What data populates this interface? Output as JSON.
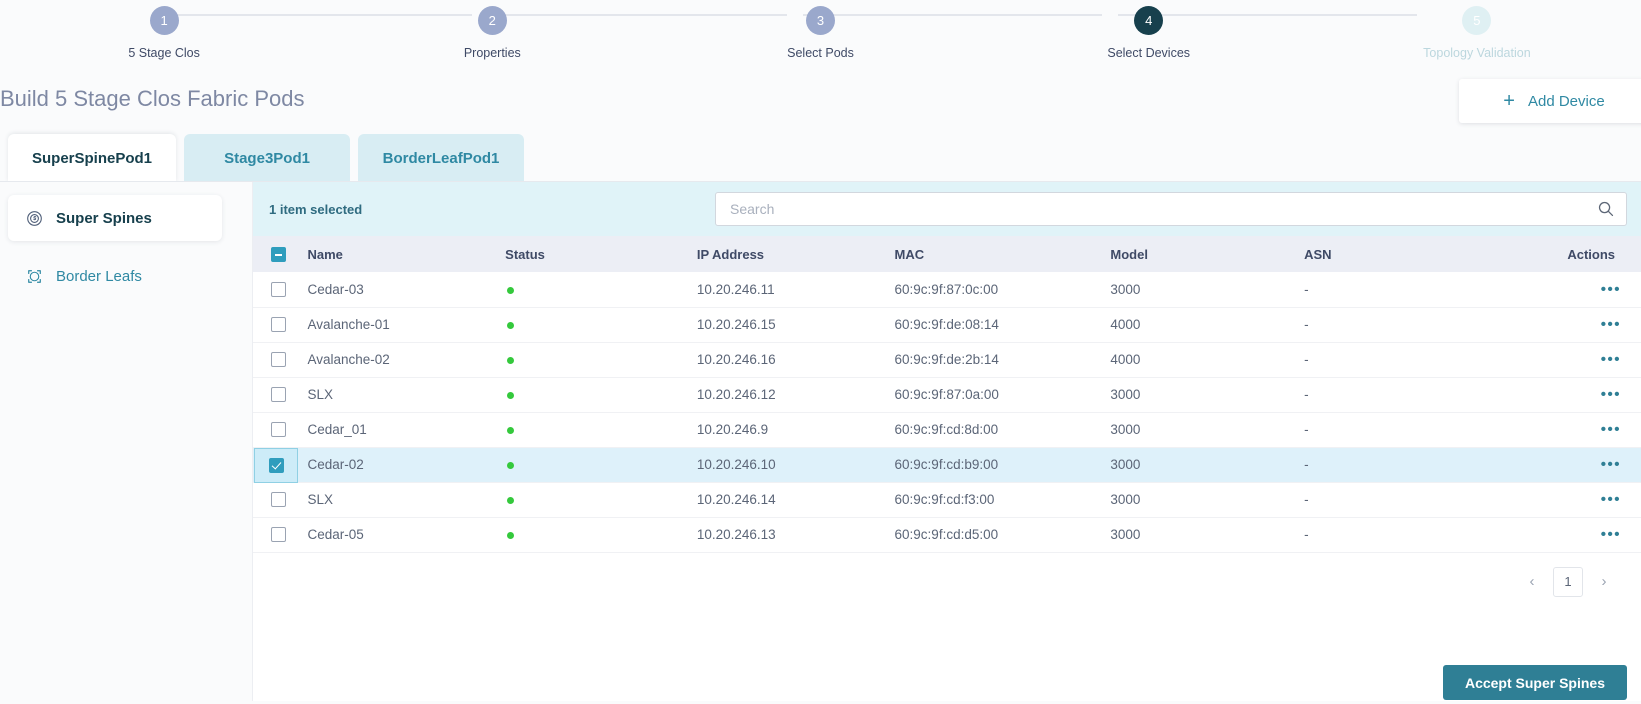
{
  "stepper": {
    "steps": [
      {
        "num": "1",
        "label": "5 Stage Clos",
        "state": "done"
      },
      {
        "num": "2",
        "label": "Properties",
        "state": "done"
      },
      {
        "num": "3",
        "label": "Select Pods",
        "state": "done"
      },
      {
        "num": "4",
        "label": "Select Devices",
        "state": "active"
      },
      {
        "num": "5",
        "label": "Topology Validation",
        "state": "disabled"
      }
    ]
  },
  "header": {
    "title": "Build 5 Stage Clos Fabric Pods",
    "add_device_label": "Add Device",
    "add_device_icon": "plus-icon"
  },
  "tabs": [
    {
      "label": "SuperSpinePod1",
      "active": true
    },
    {
      "label": "Stage3Pod1",
      "active": false
    },
    {
      "label": "BorderLeafPod1",
      "active": false
    }
  ],
  "sidebar": {
    "items": [
      {
        "label": "Super Spines",
        "icon": "super-spine-icon",
        "active": true
      },
      {
        "label": "Border Leafs",
        "icon": "border-leaf-icon",
        "active": false
      }
    ]
  },
  "toolbar": {
    "selection_text": "1 item selected",
    "search_placeholder": "Search",
    "search_value": "",
    "search_icon": "search-icon"
  },
  "table": {
    "columns": [
      "Name",
      "Status",
      "IP Address",
      "MAC",
      "Model",
      "ASN",
      "Actions"
    ],
    "header_checkbox_state": "indeterminate",
    "rows": [
      {
        "selected": false,
        "name": "Cedar-03",
        "status": "up",
        "ip": "10.20.246.11",
        "mac": "60:9c:9f:87:0c:00",
        "model": "3000",
        "asn": "-",
        "actions": "•••"
      },
      {
        "selected": false,
        "name": "Avalanche-01",
        "status": "up",
        "ip": "10.20.246.15",
        "mac": "60:9c:9f:de:08:14",
        "model": "4000",
        "asn": "-",
        "actions": "•••"
      },
      {
        "selected": false,
        "name": "Avalanche-02",
        "status": "up",
        "ip": "10.20.246.16",
        "mac": "60:9c:9f:de:2b:14",
        "model": "4000",
        "asn": "-",
        "actions": "•••"
      },
      {
        "selected": false,
        "name": "SLX",
        "status": "up",
        "ip": "10.20.246.12",
        "mac": "60:9c:9f:87:0a:00",
        "model": "3000",
        "asn": "-",
        "actions": "•••"
      },
      {
        "selected": false,
        "name": "Cedar_01",
        "status": "up",
        "ip": "10.20.246.9",
        "mac": "60:9c:9f:cd:8d:00",
        "model": "3000",
        "asn": "-",
        "actions": "•••"
      },
      {
        "selected": true,
        "name": "Cedar-02",
        "status": "up",
        "ip": "10.20.246.10",
        "mac": "60:9c:9f:cd:b9:00",
        "model": "3000",
        "asn": "-",
        "actions": "•••"
      },
      {
        "selected": false,
        "name": "SLX",
        "status": "up",
        "ip": "10.20.246.14",
        "mac": "60:9c:9f:cd:f3:00",
        "model": "3000",
        "asn": "-",
        "actions": "•••"
      },
      {
        "selected": false,
        "name": "Cedar-05",
        "status": "up",
        "ip": "10.20.246.13",
        "mac": "60:9c:9f:cd:d5:00",
        "model": "3000",
        "asn": "-",
        "actions": "•••"
      }
    ]
  },
  "pagination": {
    "prev_icon": "chevron-left-icon",
    "next_icon": "chevron-right-icon",
    "current_page": "1"
  },
  "footer": {
    "accept_label": "Accept Super Spines"
  },
  "colors": {
    "accent_teal": "#2f7f95",
    "active_step": "#17404d",
    "step_done": "#9aa8cc",
    "toolbar_bg": "#e0f3f8",
    "selected_row": "#def1fa",
    "status_up": "#34c93c"
  }
}
